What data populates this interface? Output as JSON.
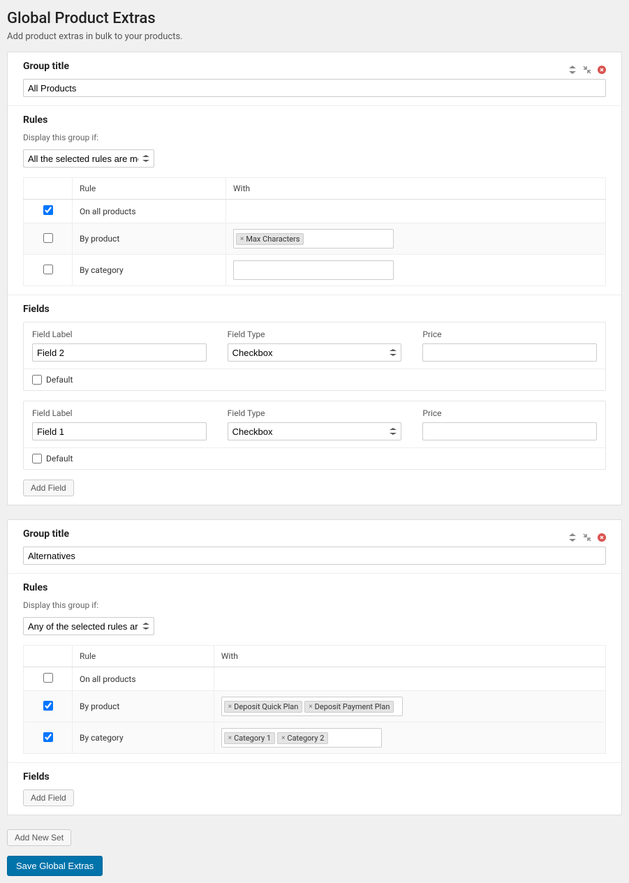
{
  "page": {
    "title": "Global Product Extras",
    "subtitle": "Add product extras in bulk to your products."
  },
  "labels": {
    "group_title": "Group title",
    "rules": "Rules",
    "display_if": "Display this group if:",
    "rule_col": "Rule",
    "with_col": "With",
    "fields": "Fields",
    "field_label": "Field Label",
    "field_type": "Field Type",
    "price": "Price",
    "default": "Default",
    "add_field": "Add Field",
    "add_new_set": "Add New Set",
    "save": "Save Global Extras",
    "rule_all_products": "On all products",
    "rule_by_product": "By product",
    "rule_by_category": "By category"
  },
  "groups": [
    {
      "title_value": "All Products",
      "rules_mode": "All the selected rules are met",
      "rules": {
        "all_products": {
          "checked": true,
          "tags": []
        },
        "by_product": {
          "checked": false,
          "tags": [
            "Max Characters"
          ]
        },
        "by_category": {
          "checked": false,
          "tags": []
        }
      },
      "fields": [
        {
          "label_value": "Field 2",
          "type_value": "Checkbox",
          "price_value": "",
          "default_checked": false
        },
        {
          "label_value": "Field 1",
          "type_value": "Checkbox",
          "price_value": "",
          "default_checked": false
        }
      ]
    },
    {
      "title_value": "Alternatives",
      "rules_mode": "Any of the selected rules are met",
      "rules": {
        "all_products": {
          "checked": false,
          "tags": []
        },
        "by_product": {
          "checked": true,
          "tags": [
            "Deposit Quick Plan",
            "Deposit Payment Plan"
          ]
        },
        "by_category": {
          "checked": true,
          "tags": [
            "Category 1",
            "Category 2"
          ]
        }
      },
      "fields": []
    }
  ]
}
